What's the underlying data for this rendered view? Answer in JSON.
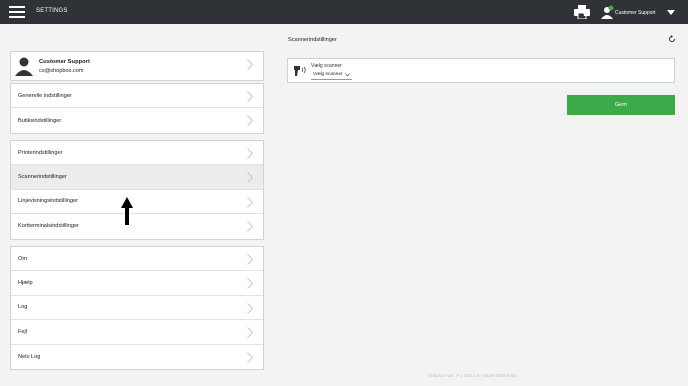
{
  "header": {
    "title": "SETTINGS",
    "user_name": "Customer Support",
    "menu_icon": "hamburger-menu-icon",
    "printer_icon": "printer-icon",
    "user_icon": "user-online-icon"
  },
  "profile": {
    "name": "Customer Support",
    "email": "cs@shopbox.com"
  },
  "groups": [
    {
      "items": [
        "Generelle indstillinger",
        "Butiksindstillinger"
      ]
    },
    {
      "items": [
        "Printerindstillinger",
        "Scannerindstillinger",
        "Linjevisningsindstillinger",
        "Kortterminalsindstillinger"
      ]
    },
    {
      "items": [
        "Om",
        "Hjælp",
        "Log",
        "Fejl",
        "Nets Log"
      ]
    }
  ],
  "active_item": "Scannerindstillinger",
  "panel": {
    "title": "Scannerindstillinger",
    "scanner_label": "Vælg scanner",
    "scanner_value": "Vælg scanner",
    "save_label": "Gem"
  },
  "footer": {
    "version": "Shopbox ver. P 1.226.1.0 | 4526-4929-5982"
  },
  "colors": {
    "topbar": "#2f3337",
    "accent_green": "#3bab4a",
    "background": "#f3f3f3"
  }
}
